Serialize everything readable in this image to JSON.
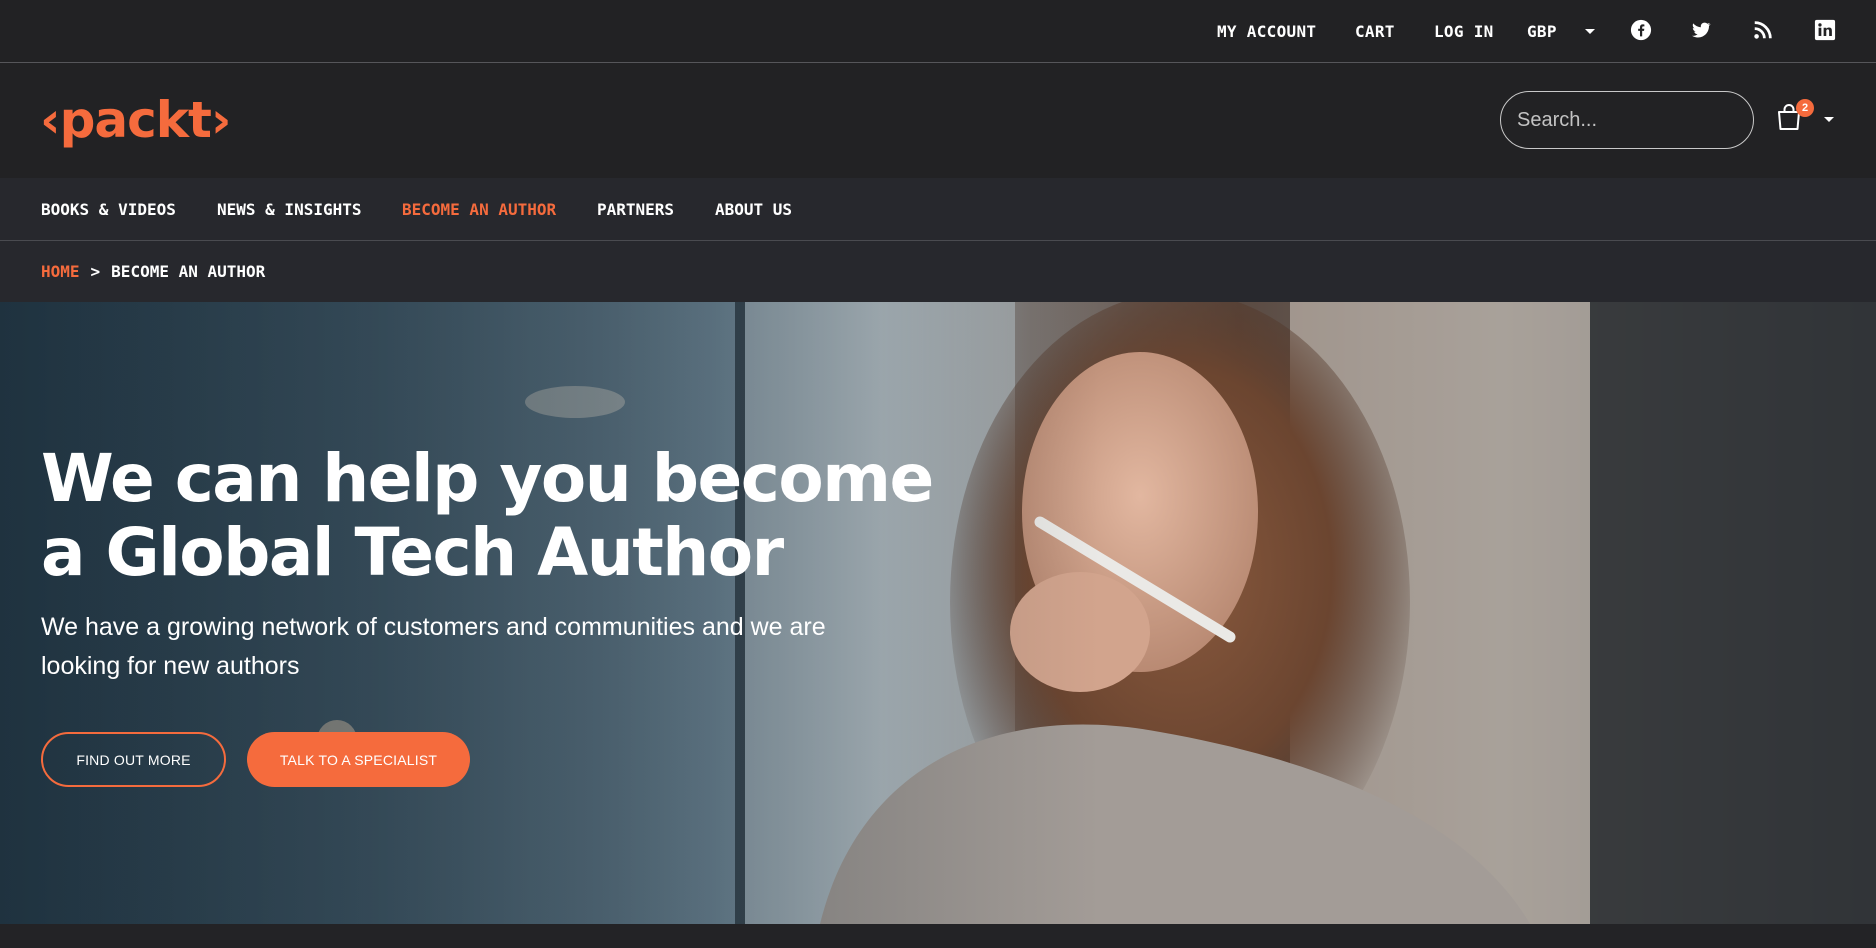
{
  "topbar": {
    "my_account": "MY ACCOUNT",
    "cart": "CART",
    "log_in": "LOG IN",
    "currency": "GBP",
    "social_icons": [
      "facebook-icon",
      "twitter-icon",
      "rss-icon",
      "linkedin-icon"
    ]
  },
  "header": {
    "logo_text": "‹packt›",
    "search_placeholder": "Search...",
    "cart_count": "2"
  },
  "nav": {
    "items": [
      {
        "label": "BOOKS & VIDEOS",
        "active": false
      },
      {
        "label": "NEWS & INSIGHTS",
        "active": false
      },
      {
        "label": "BECOME AN AUTHOR",
        "active": true
      },
      {
        "label": "PARTNERS",
        "active": false
      },
      {
        "label": "ABOUT US",
        "active": false
      }
    ]
  },
  "breadcrumb": {
    "home": "HOME",
    "separator": ">",
    "current": "BECOME AN AUTHOR"
  },
  "hero": {
    "title": "We can help you become a Global Tech Author",
    "subtitle": "We have a growing network of customers and communities and we are looking for new authors",
    "btn_find_out": "FIND OUT MORE",
    "btn_specialist": "TALK TO A SPECIALIST"
  },
  "colors": {
    "accent": "#f56b3d",
    "header_bg": "#222224",
    "nav_bg": "#27282d",
    "text": "#ffffff"
  }
}
